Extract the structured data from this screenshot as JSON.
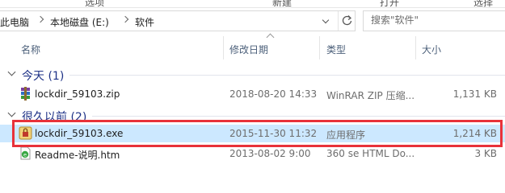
{
  "ribbon": {
    "labels": [
      "选项",
      "新建",
      "打开",
      "选择"
    ]
  },
  "address": {
    "crumbs": [
      "此电脑",
      "本地磁盘 (E:)",
      "软件"
    ]
  },
  "search": {
    "placeholder": "搜索\"软件\""
  },
  "columns": {
    "name": "名称",
    "date": "修改日期",
    "type": "类型",
    "size": "大小"
  },
  "groups": [
    {
      "title": "今天 (1)",
      "files": [
        {
          "name": "lockdir_59103.zip",
          "date": "2018-08-20 14:33",
          "type": "WinRAR ZIP 压缩...",
          "size": "1,131 KB",
          "icon": "winrar-archive-icon"
        }
      ]
    },
    {
      "title": "很久以前 (2)",
      "files": [
        {
          "name": "lockdir_59103.exe",
          "date": "2015-11-30 11:32",
          "type": "应用程序",
          "size": "1,214 KB",
          "icon": "application-lock-icon",
          "selected": true
        },
        {
          "name": "Readme-说明.htm",
          "date": "2013-08-02 9:00",
          "type": "360 se HTML Do...",
          "size": "3 KB",
          "icon": "html-document-icon"
        }
      ]
    }
  ],
  "colors": {
    "group_title": "#1e3287",
    "header_text": "#4c607a",
    "selection": "#cce8ff",
    "highlight": "#e8323a"
  }
}
